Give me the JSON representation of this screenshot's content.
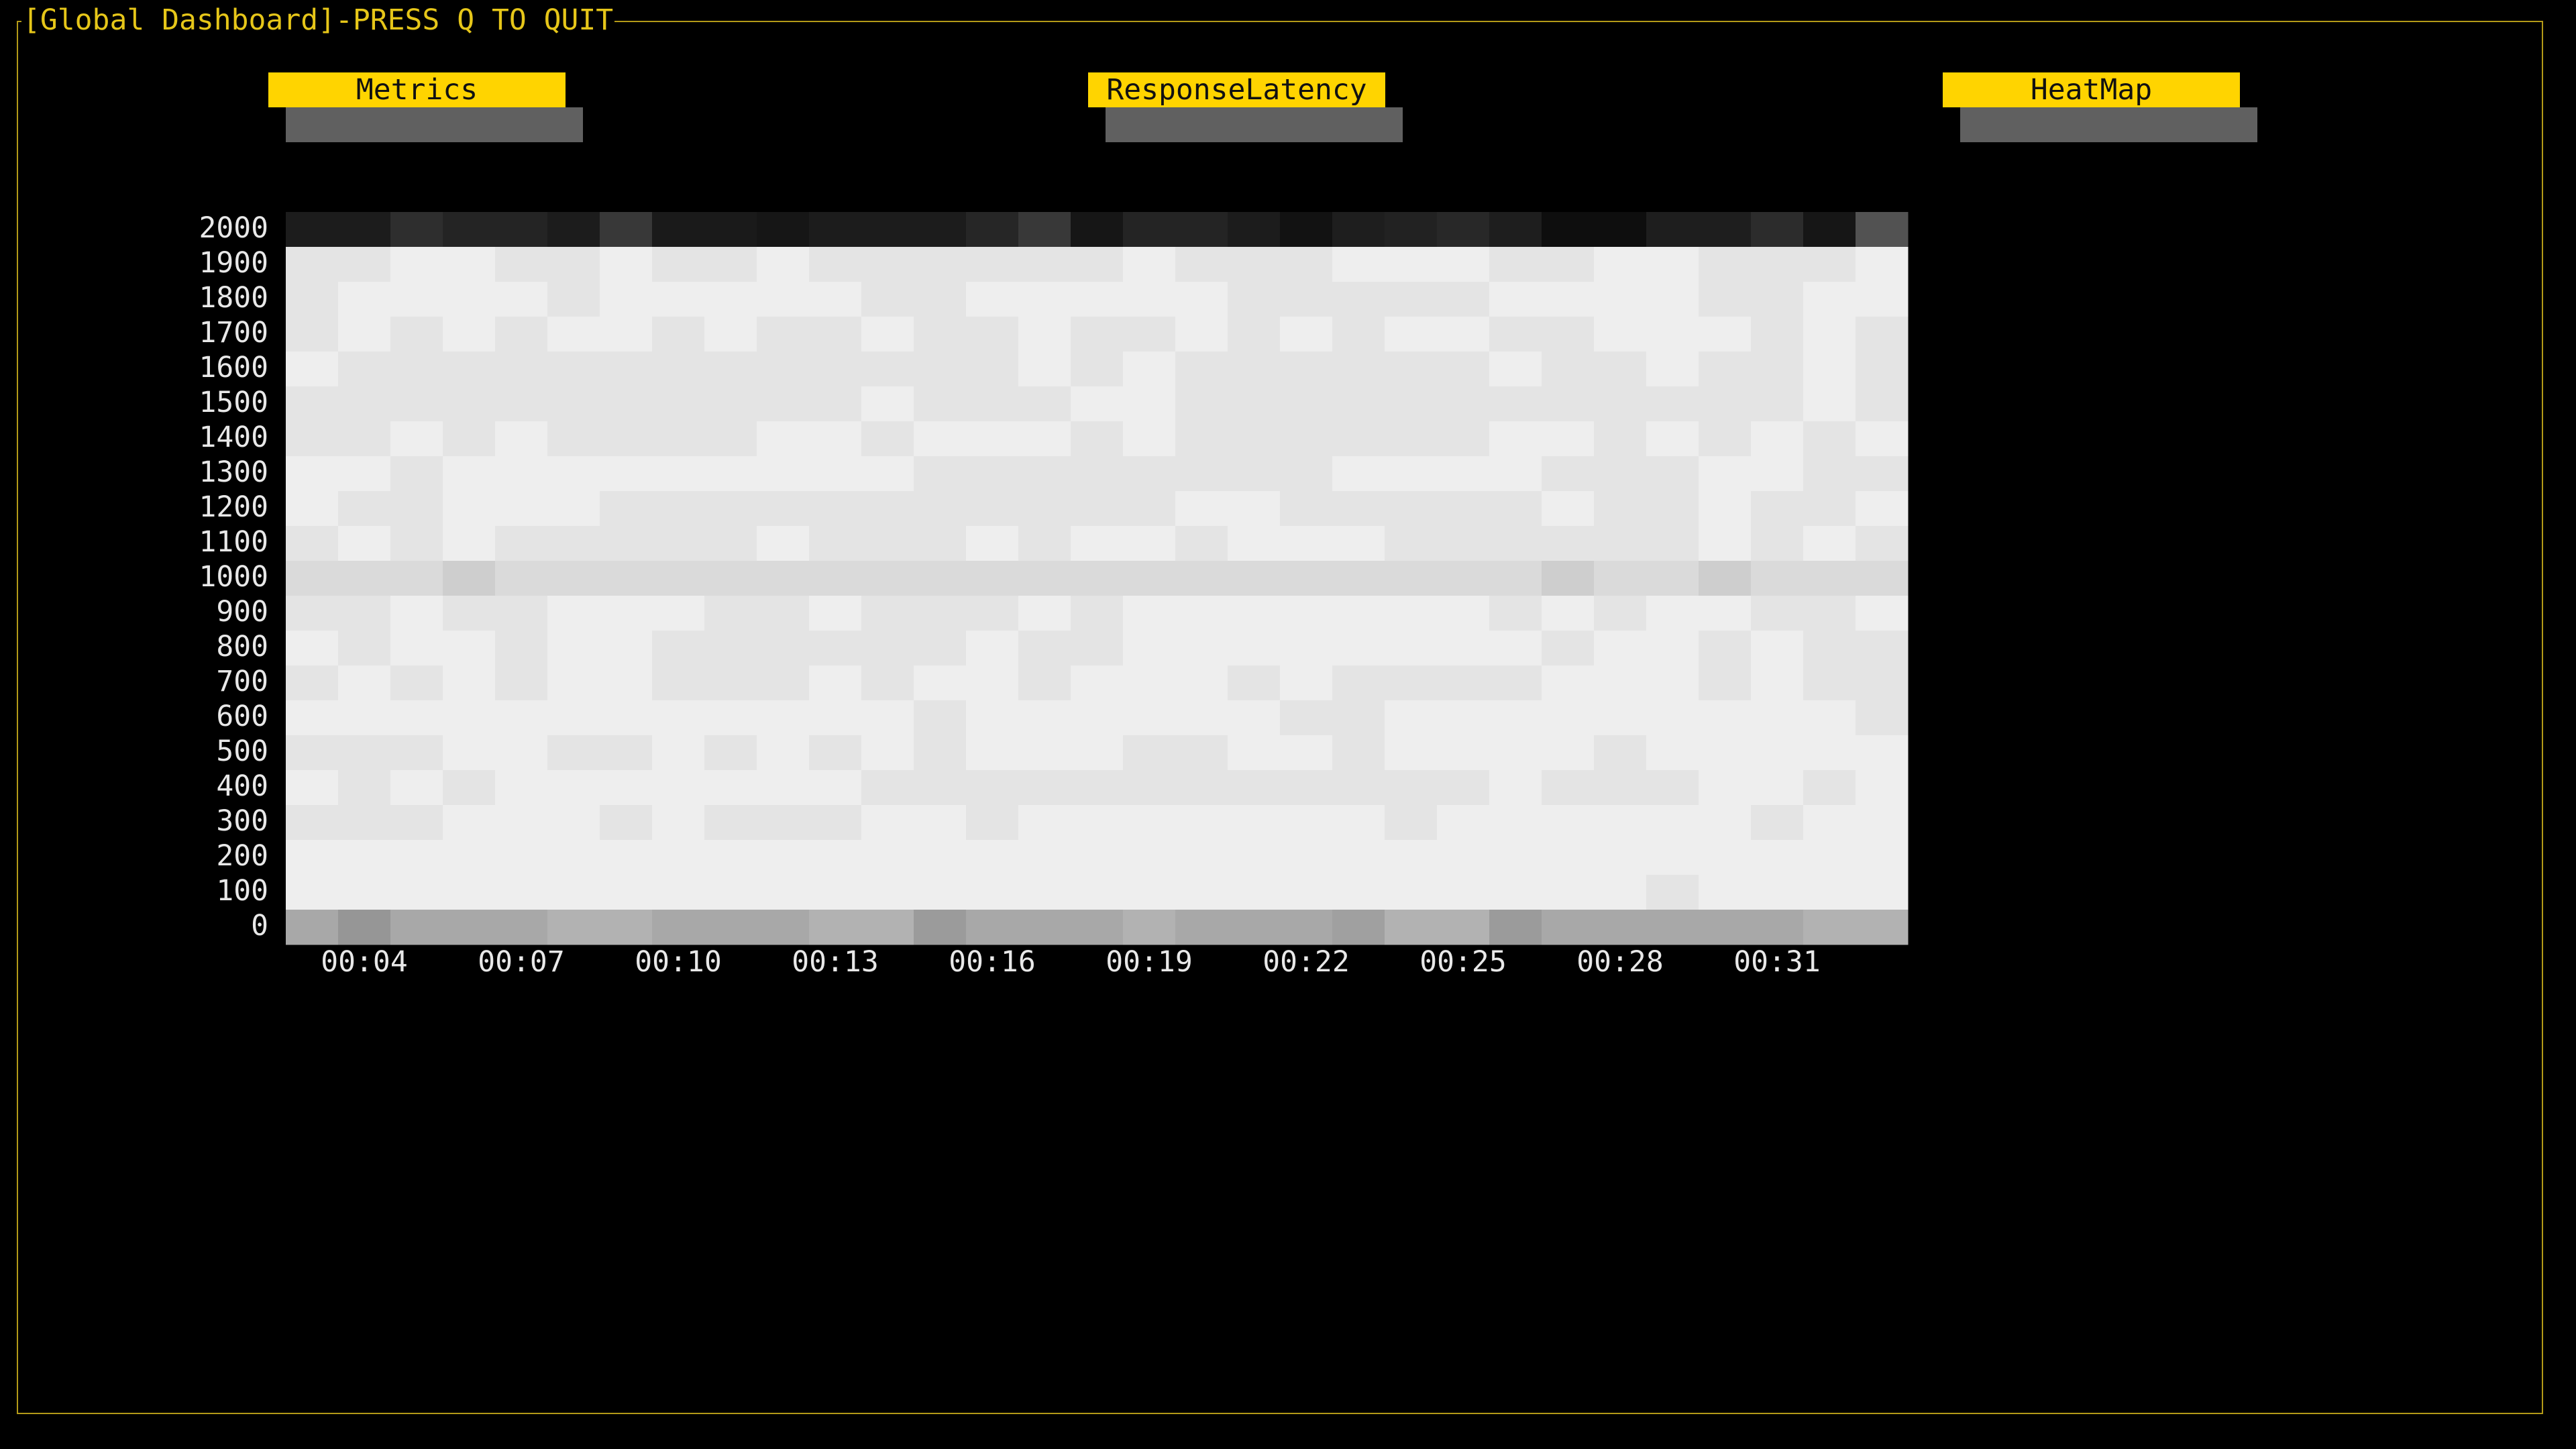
{
  "app": {
    "title": "[Global Dashboard]-PRESS Q TO QUIT"
  },
  "tabs": [
    {
      "label": "Metrics"
    },
    {
      "label": "ResponseLatency"
    },
    {
      "label": "HeatMap"
    }
  ],
  "colors": {
    "frame_border": "#b39a18",
    "frame_title": "#e6c619",
    "tab_background": "#ffd400",
    "tab_text": "#111111",
    "tab_shadow": "#606060",
    "background": "#000000",
    "label_text": "#e8e8e8"
  },
  "chart_data": {
    "type": "heatmap",
    "title": "",
    "xlabel": "",
    "ylabel": "",
    "y_tick_labels": [
      "2000",
      "1900",
      "1800",
      "1700",
      "1600",
      "1500",
      "1400",
      "1300",
      "1200",
      "1100",
      "1000",
      "900",
      "800",
      "700",
      "600",
      "500",
      "400",
      "300",
      "200",
      "100",
      "0"
    ],
    "x_tick_labels": [
      "00:04",
      "00:07",
      "00:10",
      "00:13",
      "00:16",
      "00:19",
      "00:22",
      "00:25",
      "00:28",
      "00:31"
    ],
    "x_tick_columns": [
      1,
      4,
      7,
      10,
      13,
      16,
      19,
      22,
      25,
      28
    ],
    "columns": 31,
    "value_scale": "brightness 0 (black) to 255 (white)",
    "cell_values": [
      [
        28,
        28,
        46,
        36,
        36,
        28,
        56,
        26,
        26,
        22,
        28,
        28,
        28,
        38,
        56,
        22,
        36,
        36,
        28,
        18,
        30,
        34,
        40,
        30,
        14,
        14,
        30,
        30,
        44,
        22,
        82
      ],
      [
        228,
        228,
        238,
        238,
        228,
        228,
        238,
        228,
        228,
        238,
        228,
        228,
        228,
        228,
        228,
        228,
        238,
        228,
        228,
        228,
        238,
        238,
        238,
        228,
        228,
        238,
        238,
        228,
        228,
        228,
        238
      ],
      [
        228,
        238,
        238,
        238,
        238,
        228,
        238,
        238,
        238,
        238,
        238,
        228,
        228,
        238,
        238,
        238,
        238,
        238,
        228,
        228,
        228,
        228,
        228,
        238,
        238,
        238,
        238,
        228,
        228,
        238,
        238
      ],
      [
        228,
        238,
        228,
        238,
        228,
        238,
        238,
        228,
        238,
        228,
        228,
        238,
        228,
        228,
        238,
        228,
        228,
        238,
        228,
        238,
        228,
        238,
        238,
        228,
        228,
        238,
        238,
        238,
        228,
        238,
        228
      ],
      [
        238,
        228,
        228,
        228,
        228,
        228,
        228,
        228,
        228,
        228,
        228,
        228,
        228,
        228,
        238,
        228,
        238,
        228,
        228,
        228,
        228,
        228,
        228,
        238,
        228,
        228,
        238,
        228,
        228,
        238,
        228
      ],
      [
        228,
        228,
        228,
        228,
        228,
        228,
        228,
        228,
        228,
        228,
        228,
        238,
        228,
        228,
        228,
        238,
        238,
        228,
        228,
        228,
        228,
        228,
        228,
        228,
        228,
        228,
        228,
        228,
        228,
        238,
        228
      ],
      [
        228,
        228,
        238,
        228,
        238,
        228,
        228,
        228,
        228,
        238,
        238,
        228,
        238,
        238,
        238,
        228,
        238,
        228,
        228,
        228,
        228,
        228,
        228,
        238,
        238,
        228,
        238,
        228,
        238,
        228,
        238
      ],
      [
        238,
        238,
        228,
        238,
        238,
        238,
        238,
        238,
        238,
        238,
        238,
        238,
        228,
        228,
        228,
        228,
        228,
        228,
        228,
        228,
        238,
        238,
        238,
        238,
        228,
        228,
        228,
        238,
        238,
        228,
        228
      ],
      [
        238,
        228,
        228,
        238,
        238,
        238,
        228,
        228,
        228,
        228,
        228,
        228,
        228,
        228,
        228,
        228,
        228,
        238,
        238,
        228,
        228,
        228,
        228,
        228,
        238,
        228,
        228,
        238,
        228,
        228,
        238
      ],
      [
        228,
        238,
        228,
        238,
        228,
        228,
        228,
        228,
        228,
        238,
        228,
        228,
        228,
        238,
        228,
        238,
        238,
        228,
        238,
        238,
        238,
        228,
        228,
        228,
        228,
        228,
        228,
        238,
        228,
        238,
        228
      ],
      [
        218,
        218,
        218,
        206,
        218,
        218,
        218,
        218,
        218,
        218,
        218,
        218,
        218,
        218,
        218,
        218,
        218,
        218,
        218,
        218,
        218,
        218,
        218,
        218,
        206,
        218,
        218,
        206,
        218,
        218,
        218
      ],
      [
        228,
        228,
        238,
        228,
        228,
        238,
        238,
        238,
        228,
        228,
        238,
        228,
        228,
        228,
        238,
        228,
        238,
        238,
        238,
        238,
        238,
        238,
        238,
        228,
        238,
        228,
        238,
        238,
        228,
        228,
        238
      ],
      [
        238,
        228,
        238,
        238,
        228,
        238,
        238,
        228,
        228,
        228,
        228,
        228,
        228,
        238,
        228,
        228,
        238,
        238,
        238,
        238,
        238,
        238,
        238,
        238,
        228,
        238,
        238,
        228,
        238,
        228,
        228
      ],
      [
        228,
        238,
        228,
        238,
        228,
        238,
        238,
        228,
        228,
        228,
        238,
        228,
        238,
        238,
        228,
        238,
        238,
        238,
        228,
        238,
        228,
        228,
        228,
        228,
        238,
        238,
        238,
        228,
        238,
        228,
        228
      ],
      [
        238,
        238,
        238,
        238,
        238,
        238,
        238,
        238,
        238,
        238,
        238,
        238,
        228,
        238,
        238,
        238,
        238,
        238,
        238,
        228,
        228,
        238,
        238,
        238,
        238,
        238,
        238,
        238,
        238,
        238,
        228
      ],
      [
        228,
        228,
        228,
        238,
        238,
        228,
        228,
        238,
        228,
        238,
        228,
        238,
        228,
        238,
        238,
        238,
        228,
        228,
        238,
        238,
        228,
        238,
        238,
        238,
        238,
        228,
        238,
        238,
        238,
        238,
        238
      ],
      [
        238,
        228,
        238,
        228,
        238,
        238,
        238,
        238,
        238,
        238,
        238,
        228,
        228,
        228,
        228,
        228,
        228,
        228,
        228,
        228,
        228,
        228,
        228,
        238,
        228,
        228,
        228,
        238,
        238,
        228,
        238
      ],
      [
        228,
        228,
        228,
        238,
        238,
        238,
        228,
        238,
        228,
        228,
        228,
        238,
        238,
        228,
        238,
        238,
        238,
        238,
        238,
        238,
        238,
        228,
        238,
        238,
        238,
        238,
        238,
        238,
        228,
        238,
        238
      ],
      [
        238,
        238,
        238,
        238,
        238,
        238,
        238,
        238,
        238,
        238,
        238,
        238,
        238,
        238,
        238,
        238,
        238,
        238,
        238,
        238,
        238,
        238,
        238,
        238,
        238,
        238,
        238,
        238,
        238,
        238,
        238
      ],
      [
        238,
        238,
        238,
        238,
        238,
        238,
        238,
        238,
        238,
        238,
        238,
        238,
        238,
        238,
        238,
        238,
        238,
        238,
        238,
        238,
        238,
        238,
        238,
        238,
        238,
        238,
        228,
        238,
        238,
        238,
        238
      ],
      [
        168,
        150,
        168,
        168,
        168,
        178,
        178,
        168,
        168,
        168,
        178,
        178,
        155,
        168,
        168,
        168,
        178,
        168,
        168,
        168,
        160,
        178,
        178,
        155,
        168,
        168,
        168,
        168,
        168,
        178,
        178
      ]
    ]
  }
}
